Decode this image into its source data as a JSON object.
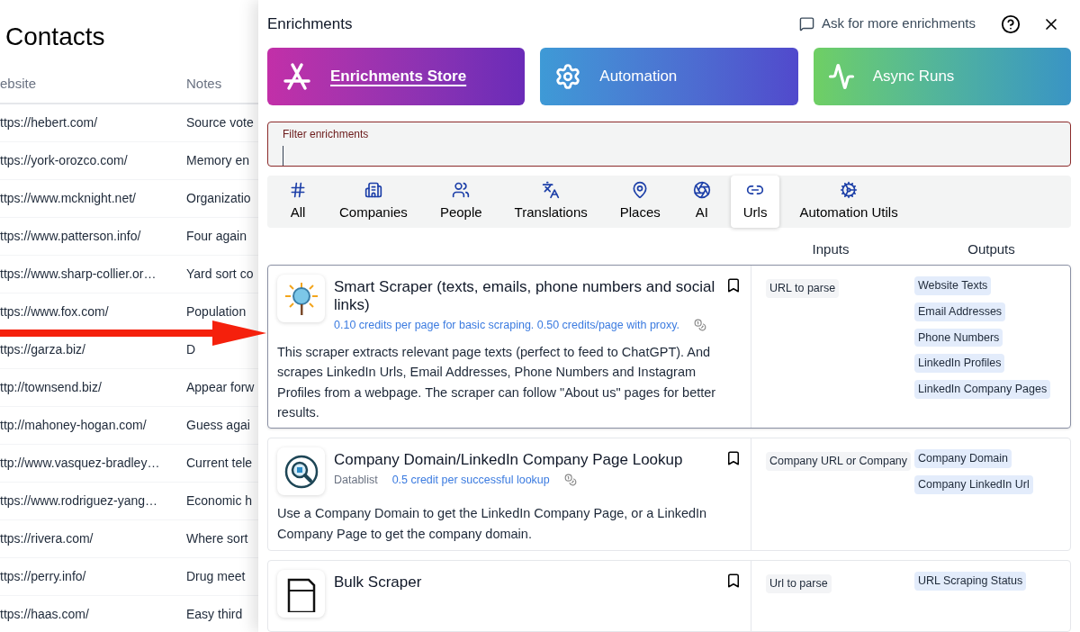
{
  "contacts": {
    "title": "Contacts",
    "columns": [
      "ebsite",
      "Notes"
    ],
    "rows": [
      [
        "ttps://hebert.com/",
        "Source vote"
      ],
      [
        "ttps://york-orozco.com/",
        "Memory en"
      ],
      [
        "ttps://www.mcknight.net/",
        "Organizatio"
      ],
      [
        "ttps://www.patterson.info/",
        "Four again"
      ],
      [
        "ttps://www.sharp-collier.or…",
        "Yard sort co"
      ],
      [
        "ttps://www.fox.com/",
        "Population"
      ],
      [
        "ttps://garza.biz/",
        "D"
      ],
      [
        "ttp://townsend.biz/",
        "Appear forw"
      ],
      [
        "ttp://mahoney-hogan.com/",
        "Guess agai"
      ],
      [
        "ttp://www.vasquez-bradley…",
        "Current tele"
      ],
      [
        "ttps://www.rodriguez-yang…",
        "Economic h"
      ],
      [
        "ttps://rivera.com/",
        "Where sort"
      ],
      [
        "ttps://perry.info/",
        "Drug meet"
      ],
      [
        "ttps://haas.com/",
        "Easy third"
      ]
    ]
  },
  "panel": {
    "title": "Enrichments",
    "ask_link": "Ask for more enrichments",
    "sections": [
      {
        "label": "Enrichments Store",
        "selected": true
      },
      {
        "label": "Automation",
        "selected": false
      },
      {
        "label": "Async Runs",
        "selected": false
      }
    ],
    "filter": {
      "label": "Filter enrichments"
    },
    "categories": [
      {
        "label": "All",
        "selected": false
      },
      {
        "label": "Companies",
        "selected": false
      },
      {
        "label": "People",
        "selected": false
      },
      {
        "label": "Translations",
        "selected": false
      },
      {
        "label": "Places",
        "selected": false
      },
      {
        "label": "AI",
        "selected": false
      },
      {
        "label": "Urls",
        "selected": true
      },
      {
        "label": "Automation Utils",
        "selected": false
      }
    ],
    "columns": [
      "Inputs",
      "Outputs"
    ],
    "enrichments": [
      {
        "title": "Smart Scraper (texts, emails, phone numbers and social links)",
        "credits": "0.10 credits per page for basic scraping. 0.50 credits/page with proxy.",
        "description": "This scraper extracts relevant page texts (perfect to feed to ChatGPT). And scrapes LinkedIn Urls, Email Addresses, Phone Numbers and Instagram Profiles from a webpage. The scraper can follow \"About us\" pages for better results.",
        "selected": true,
        "inputs": [
          "URL to parse"
        ],
        "outputs": [
          "Website Texts",
          "Email Addresses",
          "Phone Numbers",
          "LinkedIn Profiles",
          "LinkedIn Company Pages"
        ]
      },
      {
        "title": "Company Domain/LinkedIn Company Page Lookup",
        "vendor": "Datablist",
        "credits": "0.5 credit per successful lookup",
        "description": "Use a Company Domain to get the LinkedIn Company Page, or a LinkedIn Company Page to get the company domain.",
        "selected": false,
        "inputs": [
          "Company URL or Company"
        ],
        "outputs": [
          "Company Domain",
          "Company LinkedIn Url"
        ]
      },
      {
        "title": "Bulk Scraper",
        "selected": false,
        "inputs": [
          "Url to parse"
        ],
        "outputs": [
          "URL Scraping Status"
        ]
      }
    ]
  }
}
